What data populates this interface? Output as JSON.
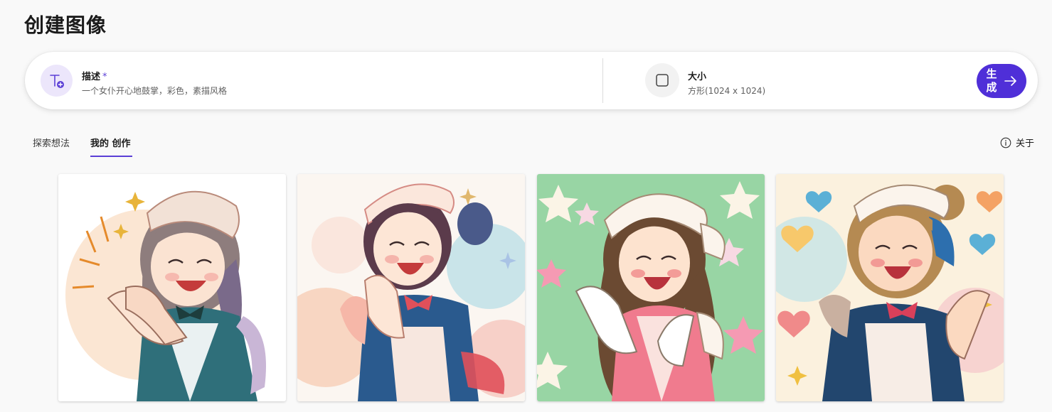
{
  "page": {
    "title": "创建图像"
  },
  "prompt": {
    "description": {
      "label": "描述",
      "required_mark": "*",
      "value": "一个女仆开心地鼓掌，彩色，素描风格",
      "icon": "text-add-icon"
    },
    "size": {
      "label": "大小",
      "value": "方形(1024 x 1024)",
      "icon": "square-icon"
    },
    "generate_button": {
      "label": "生成",
      "icon": "arrow-right-icon"
    }
  },
  "tabs": [
    {
      "label": "探索想法",
      "active": false
    },
    {
      "label": "我的 创作",
      "active": true
    }
  ],
  "about": {
    "label": "关于",
    "icon": "info-icon"
  },
  "gallery": {
    "images": [
      {
        "subject": "maid clapping, sketch style",
        "palette": {
          "bg": "#ffffff",
          "accent": "#f5c79a",
          "dress": "#2f6f7a",
          "hair": "#7a6a6a"
        }
      },
      {
        "subject": "maid clapping, watercolor",
        "palette": {
          "bg": "#fbf6f1",
          "accent": "#f4a9a0",
          "dress": "#2a5a8e",
          "hair": "#5b3b3b"
        }
      },
      {
        "subject": "maid clapping, pink dress, star background",
        "palette": {
          "bg": "#98d5a4",
          "accent": "#f59ab3",
          "dress": "#f07b8e",
          "hair": "#6b4a32"
        }
      },
      {
        "subject": "maid clapping, hearts background",
        "palette": {
          "bg": "#fbf1de",
          "accent": "#f7c86b",
          "dress": "#22466e",
          "hair": "#b58a52"
        }
      }
    ]
  },
  "colors": {
    "accent": "#4f2fd8",
    "background": "#f9f9f9"
  }
}
